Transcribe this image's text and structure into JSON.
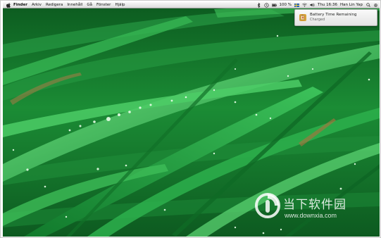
{
  "menubar": {
    "apple_icon": "apple-logo",
    "items": [
      "Finder",
      "Arkiv",
      "Redigera",
      "Innehåll",
      "Gå",
      "Fönster",
      "Hjälp"
    ],
    "status": {
      "battery_percent": "100 %",
      "clock": "Thu 16:36",
      "user": "Han Lin Yap"
    }
  },
  "notification": {
    "title": "Battery Time Remaining",
    "subtitle": "Charged"
  },
  "watermark": {
    "text": "当下软件园",
    "url": "www.downxia.com"
  },
  "colors": {
    "grass_dark": "#0e5a20",
    "grass_light": "#4fd06a",
    "menubar": "#eaeaea"
  }
}
